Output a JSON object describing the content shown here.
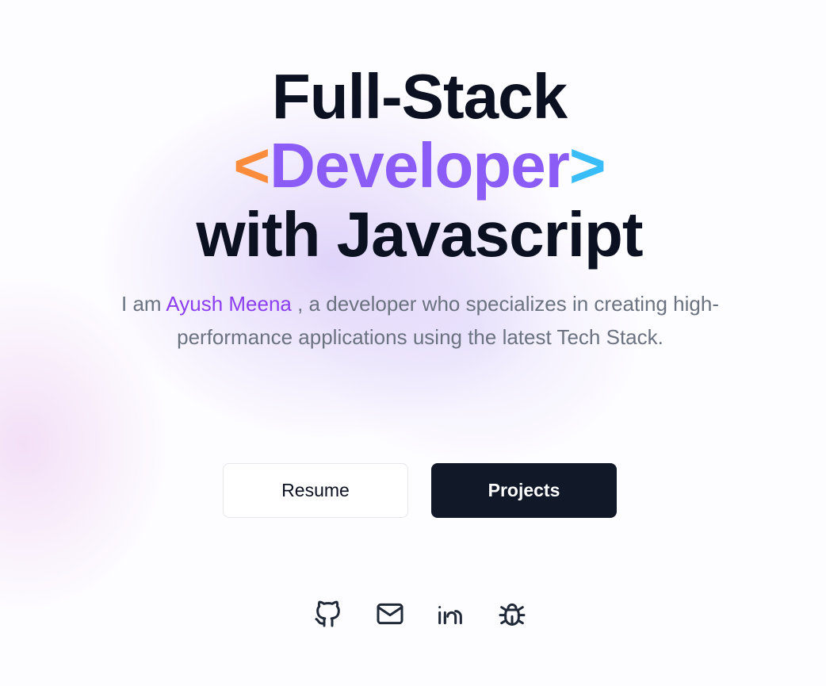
{
  "hero": {
    "line1": "Full-Stack",
    "bracket_open": "<",
    "highlight_word": "Developer",
    "bracket_close": ">",
    "line3": "with Javascript",
    "colors": {
      "heading": "#0b1120",
      "bracket_open": "#fb8c3c",
      "highlight": "#8b5cf6",
      "bracket_close": "#38bdf8"
    }
  },
  "intro": {
    "prefix": "I am ",
    "name": "Ayush Meena",
    "suffix": " , a developer who specializes in creating high-performance applications using the latest Tech Stack.",
    "name_color": "#8b3ff0"
  },
  "buttons": {
    "resume_label": "Resume",
    "projects_label": "Projects"
  },
  "socials": [
    {
      "icon": "github-icon"
    },
    {
      "icon": "mail-icon"
    },
    {
      "icon": "linkedin-icon"
    },
    {
      "icon": "bug-icon"
    }
  ]
}
